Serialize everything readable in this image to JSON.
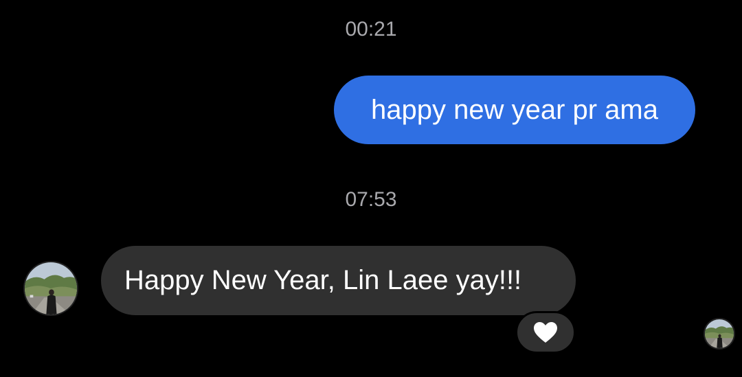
{
  "messages": [
    {
      "timestamp": "00:21",
      "sender": "me",
      "text": "happy new year pr ama"
    },
    {
      "timestamp": "07:53",
      "sender": "other",
      "text": "Happy New Year, Lin Laee yay!!!"
    }
  ],
  "reaction": {
    "icon": "heart-icon",
    "color": "#ffffff"
  },
  "colors": {
    "background": "#000000",
    "outgoing_bubble": "#2f6fe3",
    "incoming_bubble": "#303030",
    "timestamp_text": "#a9a9ad"
  }
}
